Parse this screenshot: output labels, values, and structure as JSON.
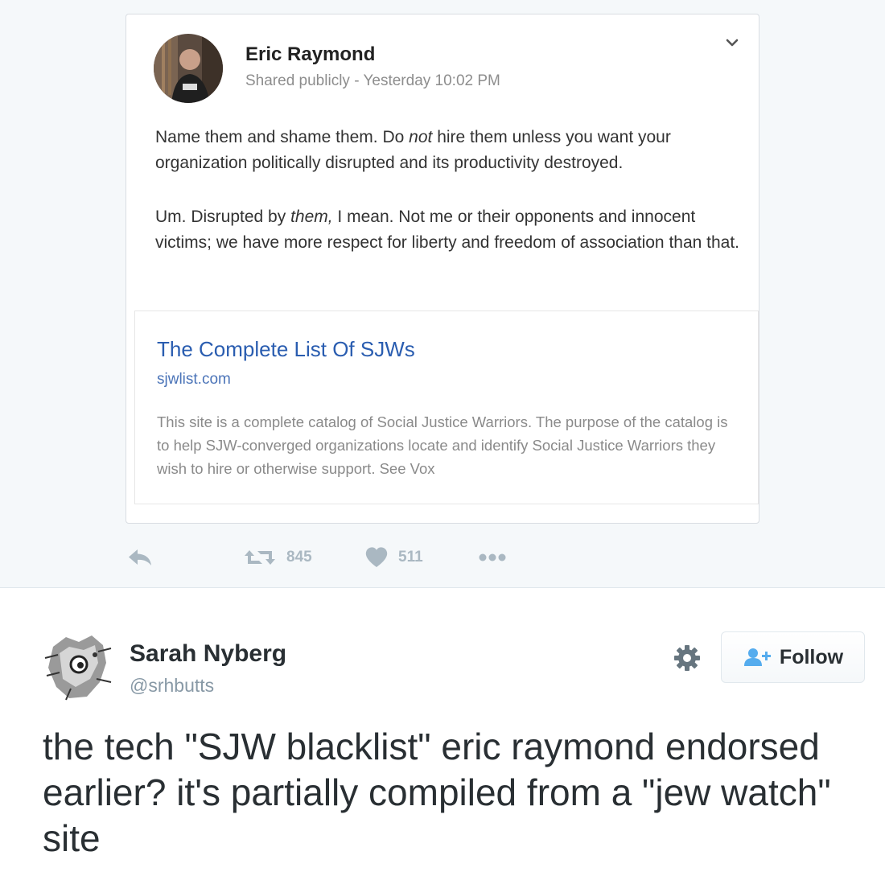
{
  "quoted_post": {
    "author_name": "Eric Raymond",
    "visibility": "Shared publicly",
    "separator": " - ",
    "timestamp": "Yesterday 10:02 PM",
    "paragraph1": {
      "before": "Name them and shame them.  Do ",
      "emphasis": "not",
      "after": " hire them unless you want your organization politically disrupted and its productivity destroyed."
    },
    "paragraph2": {
      "before": "Um. Disrupted by ",
      "emphasis": "them,",
      "after": " I mean.  Not me or their opponents and innocent victims; we have more respect for liberty and freedom of association than that."
    },
    "link_card": {
      "title": "The Complete List Of SJWs",
      "domain": "sjwlist.com",
      "description": "This site is a complete catalog of Social Justice Warriors. The purpose of the catalog is to help SJW-converged organizations locate and identify Social Justice Warriors they wish to hire or otherwise support. See Vox"
    }
  },
  "actions": {
    "retweet_count": "845",
    "like_count": "511"
  },
  "tweet": {
    "author_name": "Sarah Nyberg",
    "handle": "@srhbutts",
    "follow_label": "Follow",
    "text": "the tech \"SJW blacklist\" eric raymond endorsed earlier? it's partially compiled from a \"jew watch\" site"
  },
  "colors": {
    "link_blue": "#2a5db0",
    "follow_icon_blue": "#55acee",
    "action_gray": "#aab8c2"
  }
}
